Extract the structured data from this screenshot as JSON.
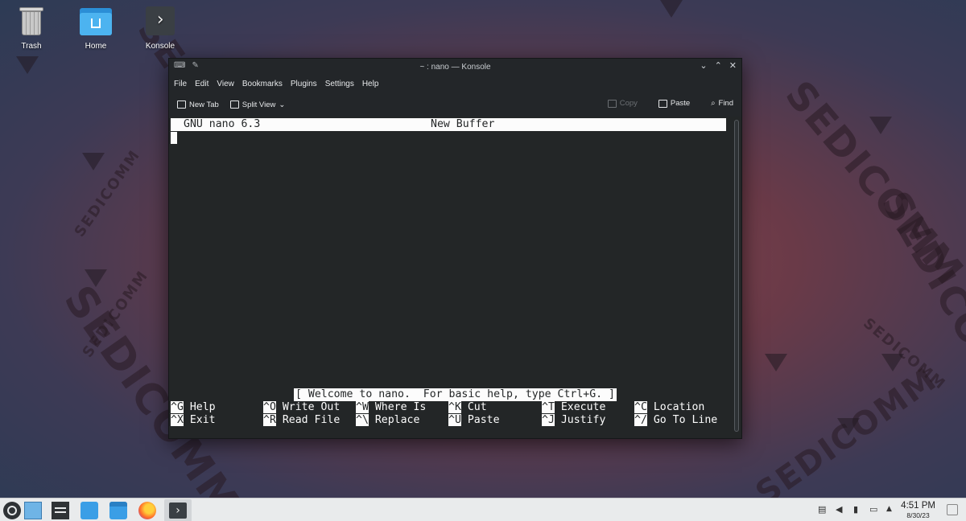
{
  "desktop": {
    "wallpaper_text": "SEDICOMM",
    "icons": [
      {
        "label": "Trash"
      },
      {
        "label": "Home"
      },
      {
        "label": "Konsole"
      }
    ]
  },
  "window": {
    "title": "~ : nano — Konsole",
    "menu": [
      "File",
      "Edit",
      "View",
      "Bookmarks",
      "Plugins",
      "Settings",
      "Help"
    ],
    "toolbar": {
      "new_tab": "New Tab",
      "split_view": "Split View",
      "copy": "Copy",
      "paste": "Paste",
      "find": "Find"
    }
  },
  "nano": {
    "version": "GNU nano 6.3",
    "buffer": "New Buffer",
    "status_message": "[ Welcome to nano.  For basic help, type Ctrl+G. ]",
    "shortcuts_row1": [
      {
        "key": "^G",
        "label": "Help"
      },
      {
        "key": "^O",
        "label": "Write Out"
      },
      {
        "key": "^W",
        "label": "Where Is"
      },
      {
        "key": "^K",
        "label": "Cut"
      },
      {
        "key": "^T",
        "label": "Execute"
      },
      {
        "key": "^C",
        "label": "Location"
      }
    ],
    "shortcuts_row2": [
      {
        "key": "^X",
        "label": "Exit"
      },
      {
        "key": "^R",
        "label": "Read File"
      },
      {
        "key": "^\\",
        "label": "Replace"
      },
      {
        "key": "^U",
        "label": "Paste"
      },
      {
        "key": "^J",
        "label": "Justify"
      },
      {
        "key": "^/",
        "label": "Go To Line"
      }
    ]
  },
  "taskbar": {
    "time": "4:51 PM",
    "date": "8/30/23"
  },
  "colors": {
    "terminal_bg": "#232627",
    "terminal_fg": "#fcfcfc",
    "window_chrome": "#232629",
    "taskbar_bg": "#e9ebec"
  }
}
